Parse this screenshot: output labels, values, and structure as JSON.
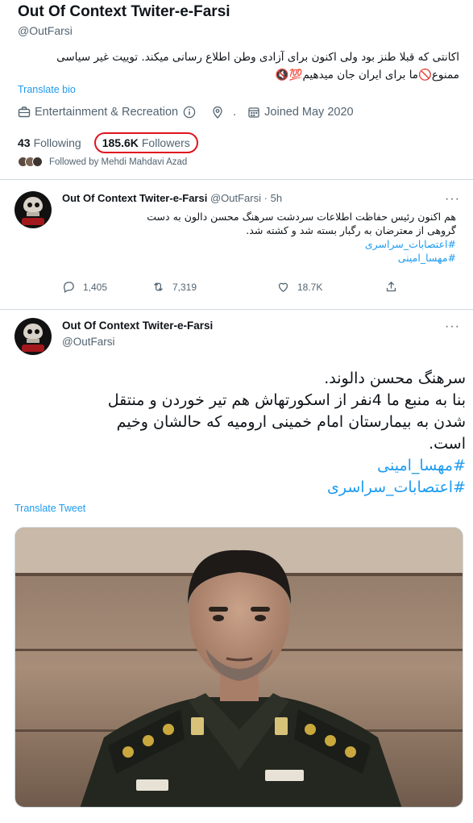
{
  "profile": {
    "name": "Out Of Context Twiter-e-Farsi",
    "handle": "@OutFarsi",
    "bio_line1": "اکانتی که قبلا طنز بود ولی اکنون برای آزادی وطن اطلاع رسانی میکند. توییت غیر سیاسی",
    "bio_line2": "ممنوع🚫ما برای ایران جان میدهیم💯🔇",
    "translate_bio": "Translate bio",
    "category": "Entertainment & Recreation",
    "location": ".",
    "joined": "Joined May 2020",
    "following_count": "43",
    "following_label": "Following",
    "followers_count": "185.6K",
    "followers_label": "Followers",
    "followed_by": "Followed by Mehdi Mahdavi Azad"
  },
  "tweet1": {
    "name": "Out Of Context Twiter-e-Farsi",
    "handle": "@OutFarsi",
    "dot": "·",
    "time": "5h",
    "line1": "هم اکنون رئیس حفاظت اطلاعات  سردشت سرهنگ محسن دالون به دست",
    "line2": "گروهی از معترضان به رگبار بسته شد و کشته شد.",
    "hashtag1": "#اعتصابات_سراسری",
    "hashtag2": "#مهسا_امینی",
    "replies": "1,405",
    "retweets": "7,319",
    "likes": "18.7K"
  },
  "tweet2": {
    "name": "Out Of Context Twiter-e-Farsi",
    "handle": "@OutFarsi",
    "line1": "سرهنگ محسن دالوند.",
    "line2": "بنا به منبع ما 4نفر از اسکورتهاش هم تیر خوردن و منتقل",
    "line3": "شدن به بیمارستان امام خمینی ارومیه که حالشان وخیم",
    "line4": "است.",
    "hashtag1": "#مهسا_امینی",
    "hashtag2": "#اعتصابات_سراسری",
    "translate": "Translate Tweet"
  },
  "icons": {
    "more": "more-icon",
    "reply": "reply-icon",
    "retweet": "retweet-icon",
    "like": "like-icon",
    "share": "share-icon"
  },
  "colors": {
    "link": "#1d9bf0",
    "muted": "#536471",
    "circle": "#e0141e"
  }
}
